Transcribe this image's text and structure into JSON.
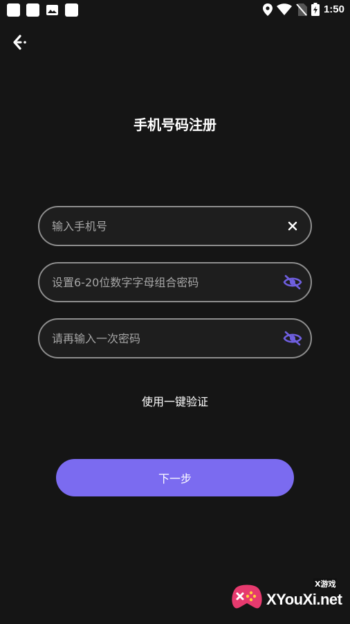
{
  "status_bar": {
    "time": "1:50",
    "left_icons": [
      "notification-icon",
      "notification-icon",
      "image-icon",
      "notification-icon"
    ],
    "right_icons": [
      "location-icon",
      "wifi-icon",
      "no-sim-icon",
      "battery-icon"
    ]
  },
  "header": {
    "back_icon": "back-arrow-icon"
  },
  "page": {
    "title": "手机号码注册"
  },
  "form": {
    "phone": {
      "placeholder": "输入手机号",
      "value": "",
      "action_icon": "clear-icon"
    },
    "password": {
      "placeholder": "设置6-20位数字字母组合密码",
      "value": "",
      "action_icon": "eye-off-icon"
    },
    "confirm_password": {
      "placeholder": "请再输入一次密码",
      "value": "",
      "action_icon": "eye-off-icon"
    }
  },
  "quick_verify": {
    "label": "使用一键验证"
  },
  "next_button": {
    "label": "下一步"
  },
  "watermark": {
    "text": "XYouXi.net",
    "tag": "X游戏"
  },
  "colors": {
    "background": "#151515",
    "accent": "#7b6bf0",
    "field_border": "#8e8e8e",
    "eye_icon": "#6f5fe0",
    "text": "#ffffff",
    "placeholder": "#a6a6a6"
  }
}
